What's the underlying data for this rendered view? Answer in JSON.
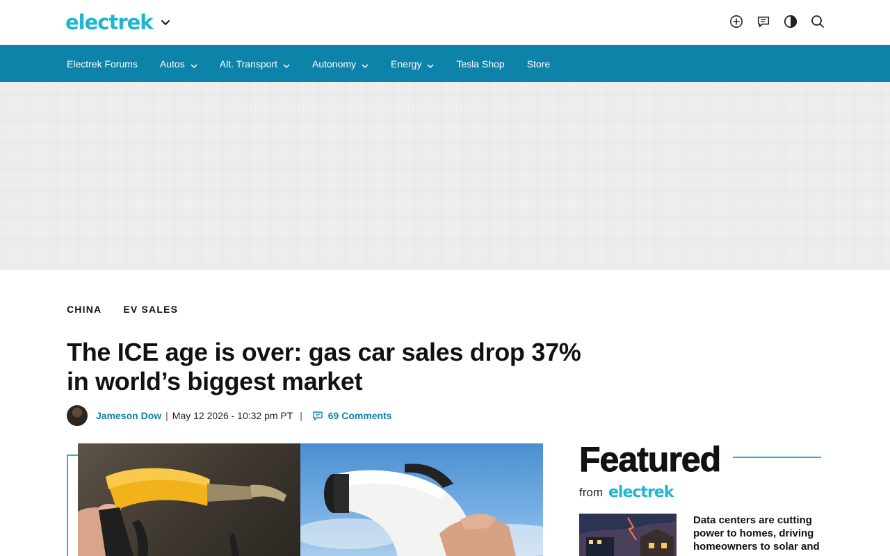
{
  "header": {
    "logo_text": "electrek",
    "icons": [
      "add-circle-icon",
      "comments-icon",
      "dark-mode-icon",
      "search-icon"
    ]
  },
  "nav": {
    "items": [
      {
        "label": "Electrek Forums",
        "has_dropdown": false
      },
      {
        "label": "Autos",
        "has_dropdown": true
      },
      {
        "label": "Alt. Transport",
        "has_dropdown": true
      },
      {
        "label": "Autonomy",
        "has_dropdown": true
      },
      {
        "label": "Energy",
        "has_dropdown": true
      },
      {
        "label": "Tesla Shop",
        "has_dropdown": false
      },
      {
        "label": "Store",
        "has_dropdown": false
      }
    ]
  },
  "article": {
    "tags": [
      "CHINA",
      "EV SALES"
    ],
    "headline": "The ICE age is over: gas car sales drop 37% in world’s biggest market",
    "author": "Jameson Dow",
    "date": "May 12 2026 - 10:32 pm PT",
    "comments": "69 Comments"
  },
  "sidebar": {
    "featured_title": "Featured",
    "from_label": "from",
    "from_logo": "electrek",
    "featured_item": {
      "title": "Data centers are cutting power to homes, driving homeowners to solar and"
    }
  },
  "colors": {
    "brand": "#1cb6cf",
    "nav_bg": "#0e83a9",
    "link": "#0e83a9"
  }
}
